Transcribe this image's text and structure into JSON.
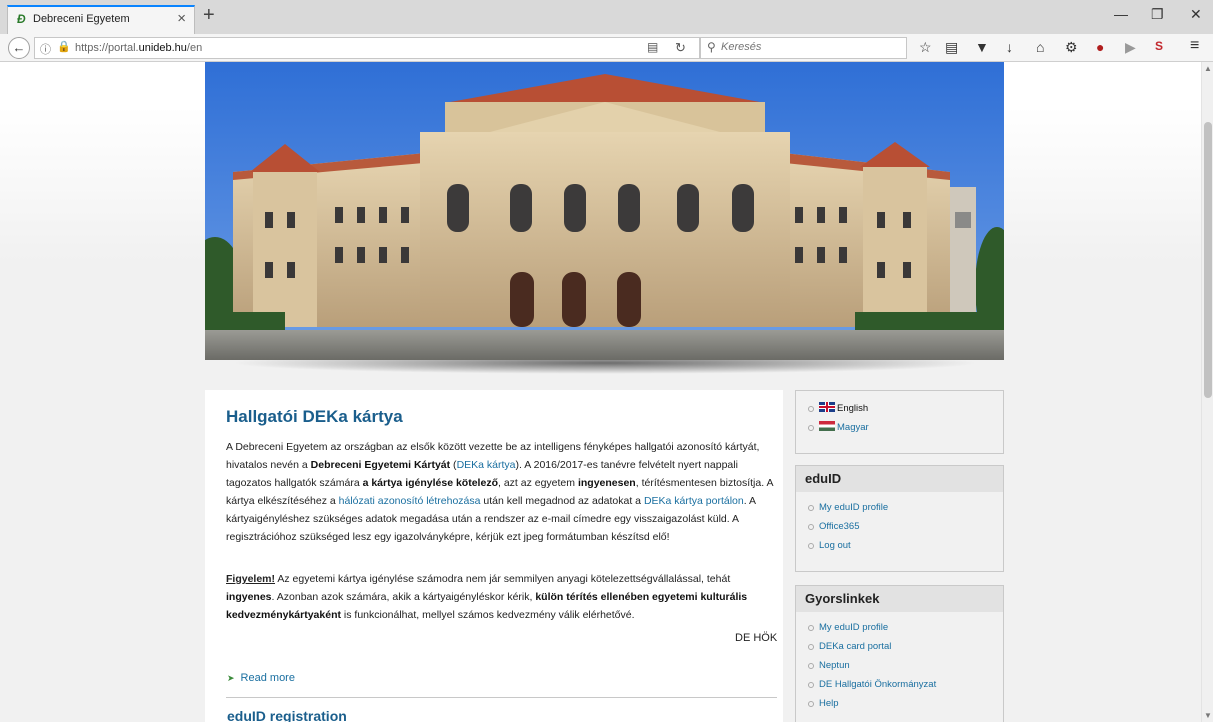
{
  "browser": {
    "tab_title": "Debreceni Egyetem",
    "tab_close": "×",
    "new_tab": "+",
    "url_prefix": "https://portal.",
    "url_domain": "unideb.hu",
    "url_suffix": "/en",
    "search_placeholder": "Keresés",
    "window_controls": [
      "—",
      "❐",
      "✕"
    ]
  },
  "main": {
    "title": "Hallgatói DEKa kártya",
    "paragraph1": [
      {
        "t": "A Debreceni Egyetem az országban az elsők között vezette be az intelligens fényképes hallgatói azonosító kártyát, hivatalos nevén a "
      },
      {
        "t": "Debreceni Egyetemi Kártyát",
        "s": "b"
      },
      {
        "t": " ("
      },
      {
        "t": "DEKa kártya",
        "s": "a"
      },
      {
        "t": "). A 2016/2017-es tanévre felvételt nyert nappali tagozatos hallgatók számára "
      },
      {
        "t": "a kártya igénylése kötelező",
        "s": "b"
      },
      {
        "t": ", azt az egyetem "
      },
      {
        "t": "ingyenesen",
        "s": "b"
      },
      {
        "t": ", térítésmentesen biztosítja. A kártya elkészítéséhez a "
      },
      {
        "t": "hálózati azonosító létrehozása",
        "s": "a"
      },
      {
        "t": " után kell megadnod az adatokat a "
      },
      {
        "t": "DEKa kártya portálon",
        "s": "a"
      },
      {
        "t": ". A kártyaigényléshez szükséges adatok megadása után a rendszer az e-mail címedre egy visszaigazolást küld. A regisztrációhoz szükséged lesz egy igazolványképre, kérjük ezt jpeg formátumban készítsd elő!"
      }
    ],
    "paragraph2": [
      {
        "t": "Figyelem!",
        "s": "u"
      },
      {
        "t": " Az egyetemi kártya igénylése számodra nem jár semmilyen anyagi kötelezettségvállalással, tehát "
      },
      {
        "t": "ingyenes",
        "s": "b"
      },
      {
        "t": ". Azonban azok számára, akik a kártyaigényléskor kérik, "
      },
      {
        "t": "külön térítés ellenében egyetemi kulturális kedvezménykártyaként",
        "s": "b"
      },
      {
        "t": " is funkcionálhat, mellyel számos kedvezmény válik elérhetővé."
      }
    ],
    "signature": "DE HÖK",
    "read_more": "Read more",
    "next_heading": "eduID registration"
  },
  "sidebar": {
    "languages": [
      {
        "label": "English",
        "flag": "uk"
      },
      {
        "label": "Magyar",
        "flag": "hu"
      }
    ],
    "eduid": {
      "title": "eduID",
      "items": [
        "My eduID profile",
        "Office365",
        "Log out"
      ]
    },
    "quicklinks": {
      "title": "Gyorslinkek",
      "items": [
        "My eduID profile",
        "DEKa card portal",
        "Neptun",
        "DE Hallgatói Önkormányzat",
        "Help"
      ]
    }
  },
  "colors": {
    "link": "#1a6fa0",
    "heading": "#1a5e8c",
    "tab_accent": "#0a84ff"
  }
}
